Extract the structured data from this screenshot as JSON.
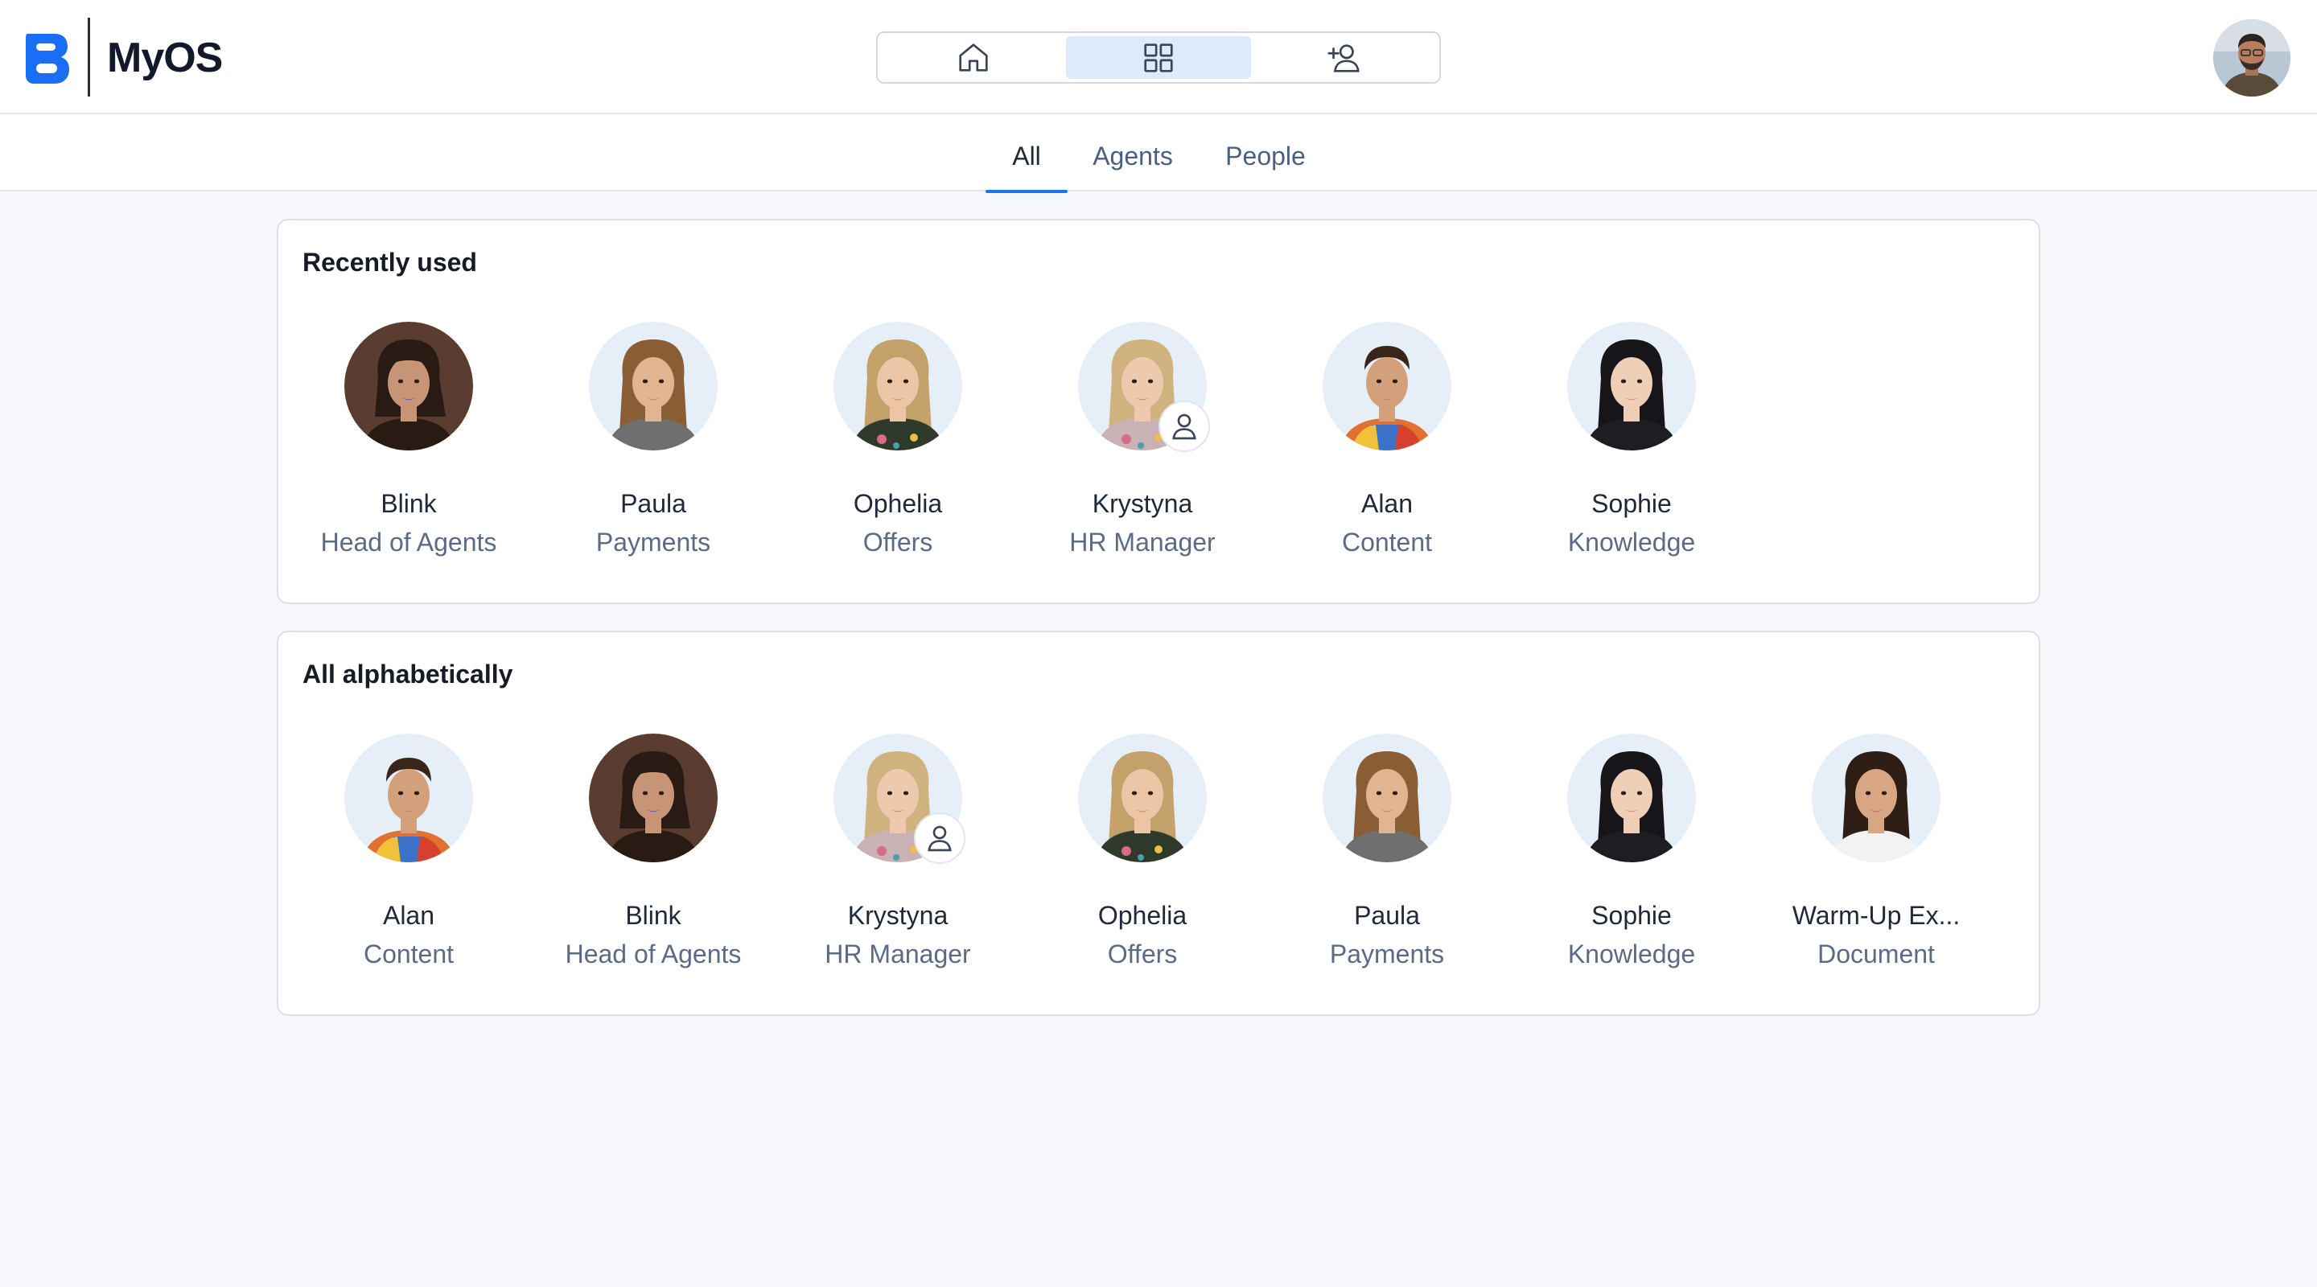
{
  "app": {
    "name": "MyOS"
  },
  "colors": {
    "accent": "#1a73e8",
    "logo": "#1a6ef5",
    "active_nav_bg": "#dfeafc"
  },
  "nav": [
    {
      "icon": "home-icon",
      "active": false
    },
    {
      "icon": "grid-icon",
      "active": true
    },
    {
      "icon": "add-person-icon",
      "active": false
    }
  ],
  "tabs": [
    {
      "label": "All",
      "active": true
    },
    {
      "label": "Agents",
      "active": false
    },
    {
      "label": "People",
      "active": false
    }
  ],
  "recently_used": {
    "title": "Recently used",
    "items": [
      {
        "name": "Blink",
        "role": "Head of Agents",
        "avatar": "blink",
        "person": false
      },
      {
        "name": "Paula",
        "role": "Payments",
        "avatar": "paula",
        "person": false
      },
      {
        "name": "Ophelia",
        "role": "Offers",
        "avatar": "ophelia",
        "person": false
      },
      {
        "name": "Krystyna",
        "role": "HR Manager",
        "avatar": "krystyna",
        "person": true
      },
      {
        "name": "Alan",
        "role": "Content",
        "avatar": "alan",
        "person": false
      },
      {
        "name": "Sophie",
        "role": "Knowledge",
        "avatar": "sophie",
        "person": false
      }
    ]
  },
  "all_alphabetically": {
    "title": "All alphabetically",
    "items": [
      {
        "name": "Alan",
        "role": "Content",
        "avatar": "alan",
        "person": false
      },
      {
        "name": "Blink",
        "role": "Head of Agents",
        "avatar": "blink",
        "person": false
      },
      {
        "name": "Krystyna",
        "role": "HR Manager",
        "avatar": "krystyna",
        "person": true
      },
      {
        "name": "Ophelia",
        "role": "Offers",
        "avatar": "ophelia",
        "person": false
      },
      {
        "name": "Paula",
        "role": "Payments",
        "avatar": "paula",
        "person": false
      },
      {
        "name": "Sophie",
        "role": "Knowledge",
        "avatar": "sophie",
        "person": false
      },
      {
        "name": "Warm-Up Ex...",
        "role": "Document",
        "avatar": "warmup",
        "person": false
      }
    ]
  }
}
